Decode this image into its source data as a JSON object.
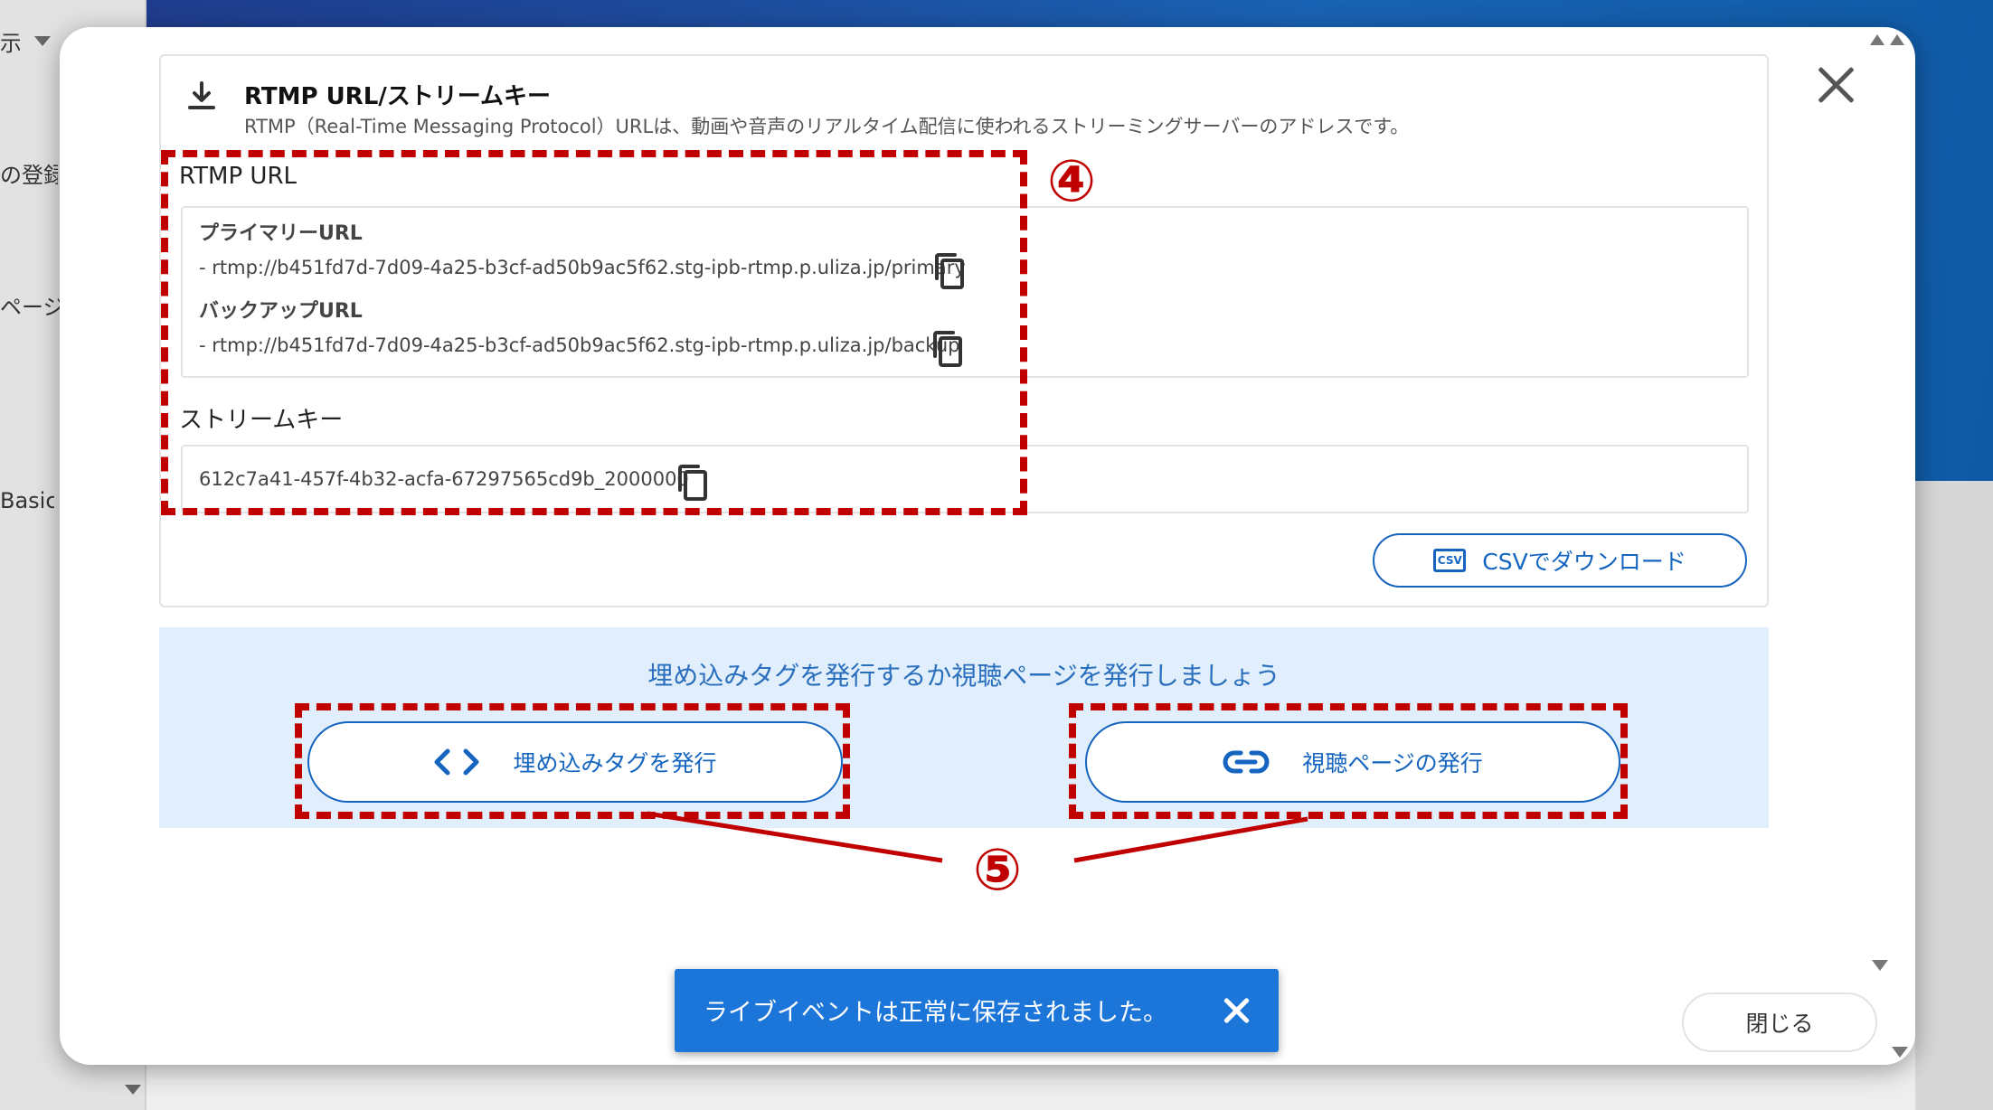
{
  "background": {
    "left_texts": [
      "示",
      "の登録",
      "ページ",
      "Basic)"
    ]
  },
  "rtmp_section": {
    "title": "RTMP URL/ストリームキー",
    "description": "RTMP（Real-Time Messaging Protocol）URLは、動画や音声のリアルタイム配信に使われるストリーミングサーバーのアドレスです。",
    "rtmp_url_label": "RTMP URL",
    "primary_label": "プライマリーURL",
    "primary_value": "- rtmp://b451fd7d-7d09-4a25-b3cf-ad50b9ac5f62.stg-ipb-rtmp.p.uliza.jp/primary",
    "backup_label": "バックアップURL",
    "backup_value": "- rtmp://b451fd7d-7d09-4a25-b3cf-ad50b9ac5f62.stg-ipb-rtmp.p.uliza.jp/backup",
    "stream_key_label": "ストリームキー",
    "stream_key_value": "612c7a41-457f-4b32-acfa-67297565cd9b_2000000",
    "csv_button_label": "CSVでダウンロード",
    "csv_icon_text": "CSV"
  },
  "issue_section": {
    "heading": "埋め込みタグを発行するか視聴ページを発行しましょう",
    "embed_button_label": "埋め込みタグを発行",
    "view_page_button_label": "視聴ページの発行"
  },
  "annotations": {
    "label_4": "④",
    "label_5": "⑤",
    "color": "#c00000"
  },
  "toast": {
    "message": "ライブイベントは正常に保存されました。"
  },
  "footer": {
    "close_button_label": "閉じる"
  },
  "colors": {
    "primary": "#1565c0",
    "toast_bg": "#1c75d8",
    "panel_bg": "#e1eefb"
  }
}
